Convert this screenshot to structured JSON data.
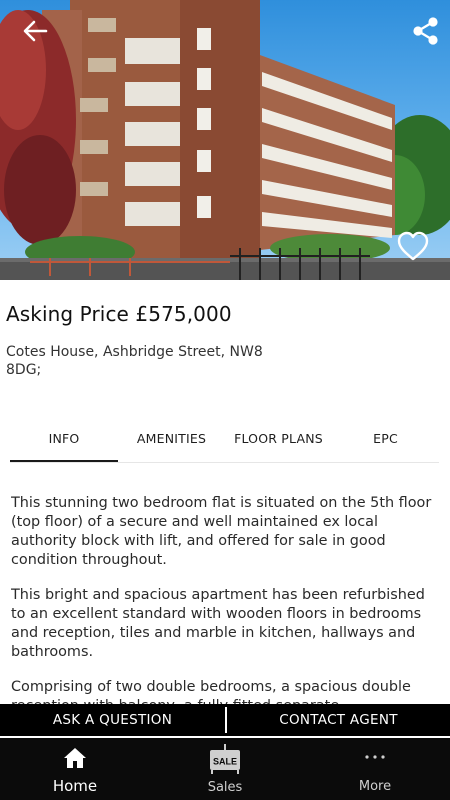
{
  "listing": {
    "price_label": "Asking Price £575,000",
    "address": "Cotes House, Ashbridge Street, NW8 8DG;"
  },
  "tabs": [
    {
      "label": "INFO",
      "active": true
    },
    {
      "label": "AMENITIES",
      "active": false
    },
    {
      "label": "FLOOR PLANS",
      "active": false
    },
    {
      "label": "EPC",
      "active": false
    }
  ],
  "description": [
    "This stunning two bedroom flat is situated on the 5th floor (top floor) of a secure and well maintained ex local authority block with lift, and offered for sale in good condition throughout.",
    "This bright and spacious apartment has been refurbished to an excellent standard with wooden floors in bedrooms and reception, tiles and marble in kitchen, hallways and bathrooms.",
    "Comprising of two double bedrooms, a spacious double reception with balcony, a fully fitted separate"
  ],
  "actions": {
    "ask_label": "ASK A QUESTION",
    "contact_label": "CONTACT AGENT"
  },
  "bottom_nav": {
    "home_label": "Home",
    "sales_label": "Sales",
    "sales_icon_text": "SALE",
    "more_label": "More"
  },
  "icons": {
    "back": "arrow-left-icon",
    "share": "share-icon",
    "favorite": "heart-outline-icon",
    "home": "home-icon",
    "sales": "sale-sign-icon",
    "more": "dots-horizontal-icon"
  },
  "colors": {
    "action_bar": "#000000",
    "bottom_nav": "#0b0b0b",
    "sky": "#4aa3e6",
    "brick": "#9a5a3e"
  }
}
